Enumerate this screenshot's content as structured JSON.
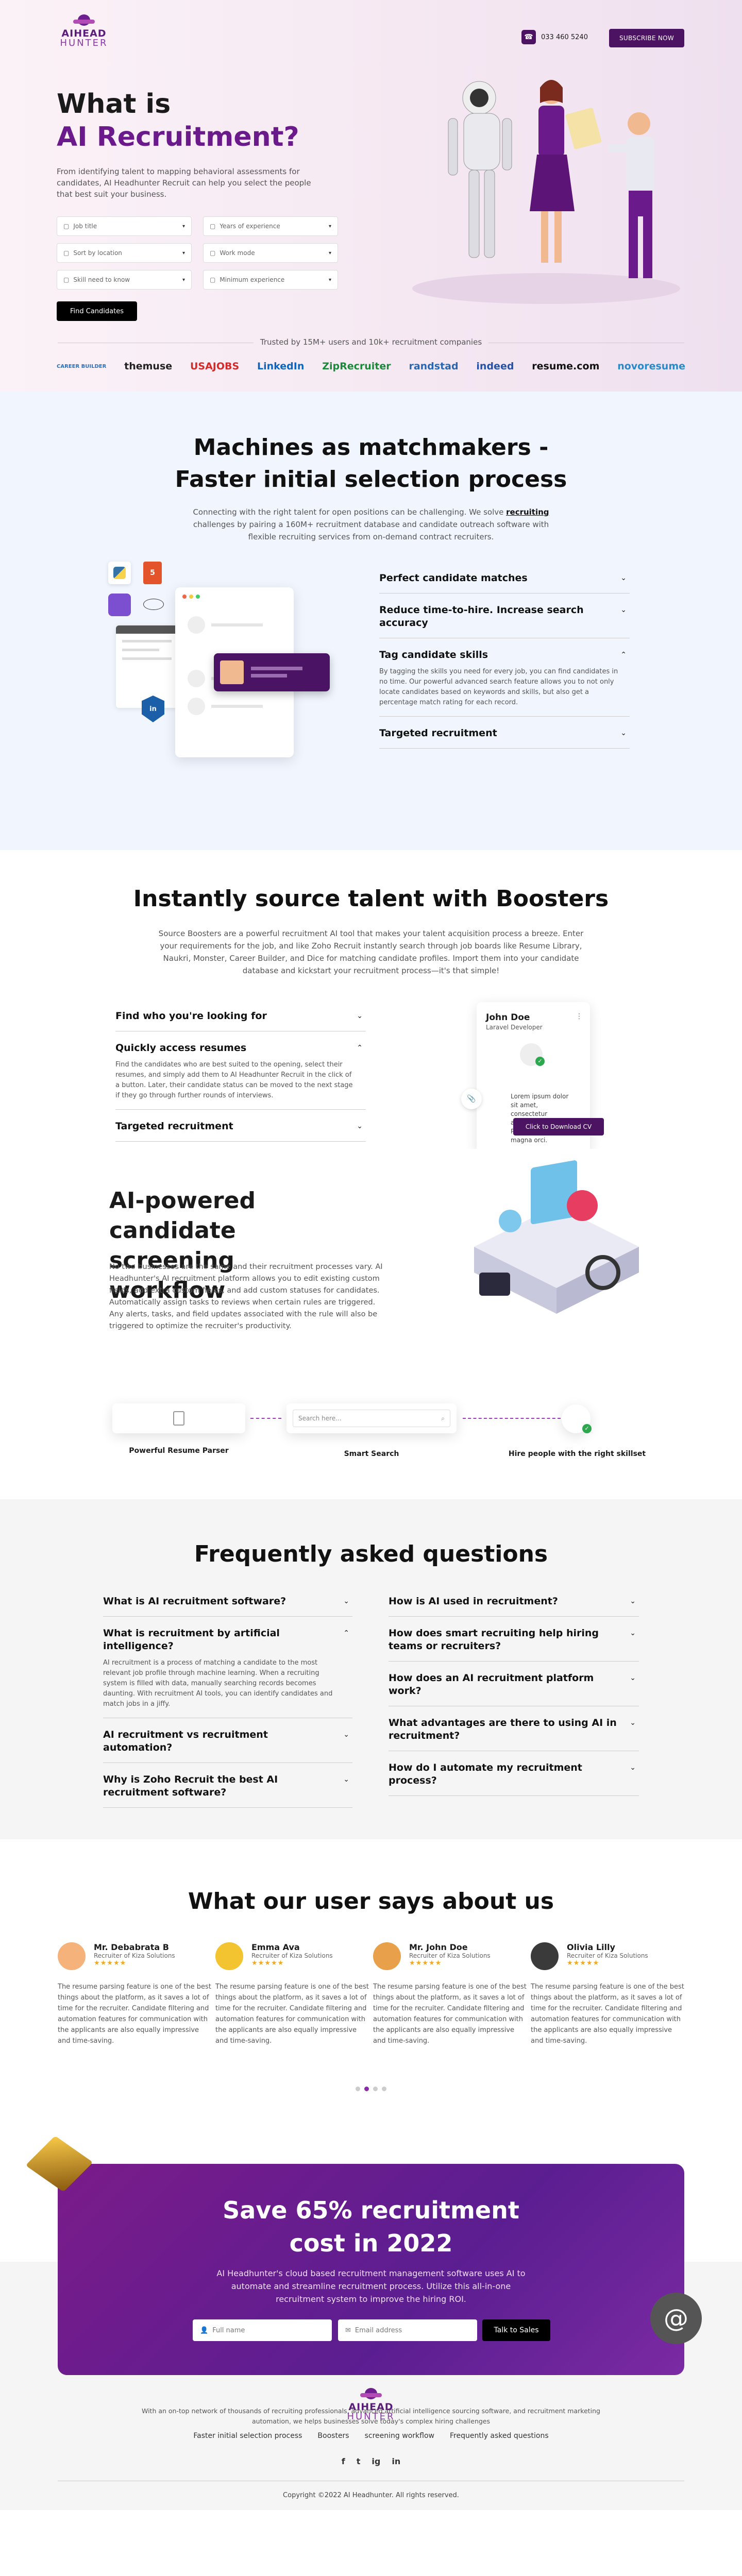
{
  "header": {
    "logo_top": "AIHEAD",
    "logo_bottom": "HUNTER",
    "phone": "033 460 5240",
    "subscribe": "SUBSCRIBE NOW"
  },
  "hero": {
    "title_line1": "What is",
    "title_line2": "AI Recruitment?",
    "description": "From identifying talent to mapping behavioral assessments for candidates, AI Headhunter Recruit can help you select the people that best suit your business.",
    "filters": [
      {
        "label": "Job title",
        "icon": "briefcase-icon"
      },
      {
        "label": "Years of experience",
        "icon": "calendar-icon"
      },
      {
        "label": "Sort by location",
        "icon": "location-icon"
      },
      {
        "label": "Work mode",
        "icon": "laptop-icon"
      },
      {
        "label": "Skill need to know",
        "icon": "skill-icon"
      },
      {
        "label": "Minimum experience",
        "icon": "clock-icon"
      }
    ],
    "find_button": "Find Candidates",
    "trusted_text": "Trusted by 15M+ users and 10k+ recruitment companies",
    "companies": [
      "CAREER BUILDER",
      "themuse",
      "USAJOBS",
      "LinkedIn",
      "ZipRecruiter",
      "randstad",
      "indeed",
      "resume.com",
      "novoresume"
    ]
  },
  "matchmakers": {
    "title": "Machines as matchmakers - Faster initial selection process",
    "description_pre": "Connecting with the right talent for open positions can be challenging. We solve ",
    "description_link": "recruiting",
    "description_post": " challenges by pairing a 160M+ recruitment database and candidate outreach software with flexible recruiting services from on-demand contract recruiters.",
    "accordion": [
      {
        "title": "Perfect candidate matches",
        "open": false,
        "content": ""
      },
      {
        "title": "Reduce time-to-hire. Increase search accuracy",
        "open": false,
        "content": ""
      },
      {
        "title": "Tag candidate skills",
        "open": true,
        "content": "By tagging the skills you need for every job, you can find candidates in no time. Our powerful advanced search feature allows you to not only locate candidates based on keywords and skills, but also get a percentage match rating for each record."
      },
      {
        "title": "Targeted recruitment",
        "open": false,
        "content": ""
      }
    ]
  },
  "boosters": {
    "title": "Instantly source talent with Boosters",
    "description": "Source Boosters are a powerful recruitment AI tool that makes your talent acquisition process a breeze. Enter your requirements for the job, and like Zoho Recruit instantly search through job boards like Resume Library, Naukri, Monster, Career Builder, and Dice for matching candidate profiles. Import them into your candidate database and kickstart your recruitment process—it's that simple!",
    "accordion": [
      {
        "title": "Find who you're looking for",
        "open": false,
        "content": ""
      },
      {
        "title": "Quickly access resumes",
        "open": true,
        "content": "Find the candidates who are best suited to the opening, select their resumes, and simply add them to AI Headhunter Recruit in the click of a button. Later, their candidate status can be moved to the next stage if they go through further rounds of interviews."
      },
      {
        "title": "Targeted recruitment",
        "open": false,
        "content": ""
      }
    ],
    "profile": {
      "name": "John Doe",
      "role": "Laravel Developer",
      "note": "Lorem ipsum dolor sit amet, consectetur adipiscing elit. Phasellus ultricies magna orci.",
      "download": "Click to Download CV"
    }
  },
  "screening": {
    "title": "AI-powered candidate screening workflow",
    "description": "No two businesses are the same and their recruitment processes vary. AI Headhunter's AI recruitment platform allows you to edit existing custom fields, add extra custom fields, and add custom statuses for candidates. Automatically assign tasks to reviews when certain rules are triggered. Any alerts, tasks, and field updates associated with the rule will also be triggered to optimize the recruiter's productivity.",
    "steps": [
      "Powerful Resume Parser",
      "Smart Search",
      "Hire people with the right skillset"
    ],
    "search_placeholder": "Search here..."
  },
  "faq": {
    "title": "Frequently asked questions",
    "left": [
      {
        "q": "What is AI recruitment software?",
        "open": false,
        "a": ""
      },
      {
        "q": "What is recruitment by artificial intelligence?",
        "open": true,
        "a": "AI recruitment is a process of matching a candidate to the most relevant job profile through machine learning. When a recruiting system is filled with data, manually searching records becomes daunting. With recruitment AI tools, you can identify candidates and match jobs in a jiffy."
      },
      {
        "q": "AI recruitment vs recruitment automation?",
        "open": false,
        "a": ""
      },
      {
        "q": "Why is Zoho Recruit the best AI recruitment software?",
        "open": false,
        "a": ""
      }
    ],
    "right": [
      {
        "q": "How is AI used in recruitment?",
        "open": false,
        "a": ""
      },
      {
        "q": "How does smart recruiting help hiring teams or recruiters?",
        "open": false,
        "a": ""
      },
      {
        "q": "How does an AI recruitment platform work?",
        "open": false,
        "a": ""
      },
      {
        "q": "What advantages are there to using AI in recruitment?",
        "open": false,
        "a": ""
      },
      {
        "q": "How do I automate my recruitment process?",
        "open": false,
        "a": ""
      }
    ]
  },
  "testimonials": {
    "title": "What our user says about us",
    "items": [
      {
        "name": "Mr. Debabrata B",
        "role": "Recruiter of Kiza Solutions",
        "stars": "★★★★★",
        "text": "The resume parsing feature is one of the best things about the platform, as it saves a lot of time for the recruiter. Candidate filtering and automation features for communication with the applicants are also equally impressive and time-saving.",
        "color": "#f5b27a"
      },
      {
        "name": "Emma Ava",
        "role": "Recruiter of Kiza Solutions",
        "stars": "★★★★★",
        "text": "The resume parsing feature is one of the best things about the platform, as it saves a lot of time for the recruiter. Candidate filtering and automation features for communication with the applicants are also equally impressive and time-saving.",
        "color": "#f4c430"
      },
      {
        "name": "Mr. John Doe",
        "role": "Recruiter of Kiza Solutions",
        "stars": "★★★★★",
        "text": "The resume parsing feature is one of the best things about the platform, as it saves a lot of time for the recruiter. Candidate filtering and automation features for communication with the applicants are also equally impressive and time-saving.",
        "color": "#e8a04a"
      },
      {
        "name": "Olivia Lilly",
        "role": "Recruiter of Kiza Solutions",
        "stars": "★★★★★",
        "text": "The resume parsing feature is one of the best things about the platform, as it saves a lot of time for the recruiter. Candidate filtering and automation features for communication with the applicants are also equally impressive and time-saving.",
        "color": "#3a3a3a"
      }
    ]
  },
  "cta": {
    "title": "Save 65% recruitment cost in 2022",
    "description": "AI Headhunter's cloud based recruitment management software uses AI to automate and streamline recruitment process. Utilize this all-in-one recruitment system to improve the hiring ROI.",
    "name_placeholder": "Full name",
    "email_placeholder": "Email address",
    "button": "Talk to Sales"
  },
  "footer": {
    "about": "With an on-top network of thousands of recruiting professionals, advanced artificial intelligence sourcing software, and recruitment marketing automation, we helps businesses solve today's complex hiring challenges",
    "links": [
      "Faster initial selection process",
      "Boosters",
      "screening workflow",
      "Frequently asked questions"
    ],
    "social": [
      "f",
      "t",
      "ig",
      "in"
    ],
    "copyright": "Copyright ©2022 AI Headhunter. All rights reserved."
  }
}
